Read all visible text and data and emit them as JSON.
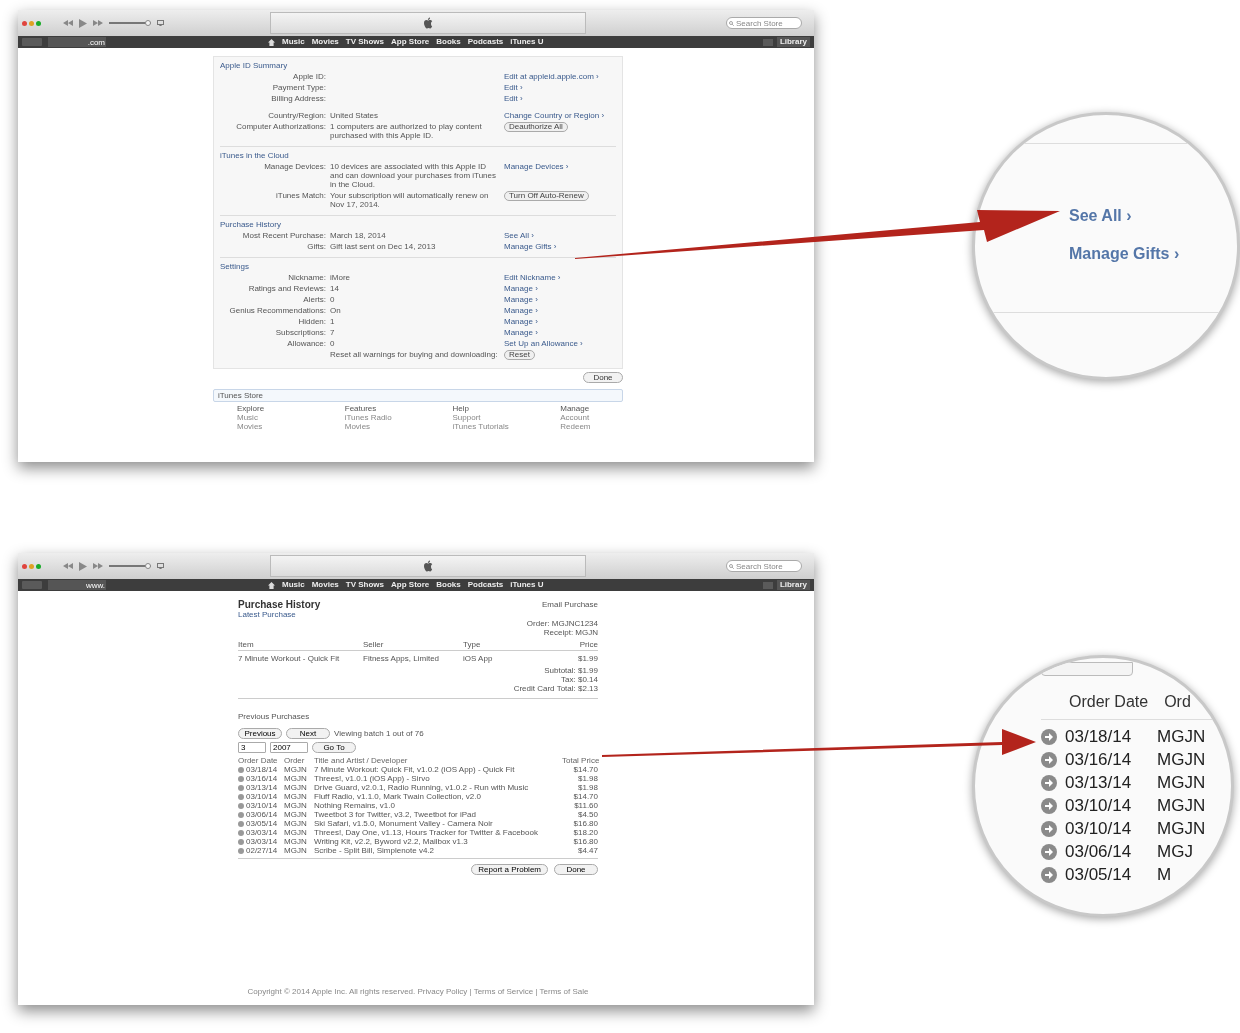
{
  "top_window": {
    "volume": {
      "level": 0.95
    },
    "search": {
      "placeholder": "Search Store"
    },
    "address": ".com",
    "nav": [
      "Music",
      "Movies",
      "TV Shows",
      "App Store",
      "Books",
      "Podcasts",
      "iTunes U"
    ],
    "library": "Library",
    "sections": [
      {
        "title": "Apple ID Summary",
        "rows": [
          {
            "label": "Apple ID:",
            "value": "",
            "action": "Edit at appleid.apple.com ›",
            "kind": "link"
          },
          {
            "label": "Payment Type:",
            "value": "",
            "action": "Edit ›",
            "kind": "link"
          },
          {
            "label": "Billing Address:",
            "value": "",
            "action": "Edit ›",
            "kind": "link"
          },
          {
            "label": "Country/Region:",
            "value": "United States",
            "action": "Change Country or Region ›",
            "kind": "link"
          },
          {
            "label": "Computer Authorizations:",
            "value": "1 computers are authorized to play content purchased with this Apple ID.",
            "action": "Deauthorize All",
            "kind": "button"
          }
        ]
      },
      {
        "title": "iTunes in the Cloud",
        "rows": [
          {
            "label": "Manage Devices:",
            "value": "10 devices are associated with this Apple ID and can download your purchases from iTunes in the Cloud.",
            "action": "Manage Devices ›",
            "kind": "link"
          },
          {
            "label": "iTunes Match:",
            "value": "Your subscription will automatically renew on Nov 17, 2014.",
            "action": "Turn Off Auto-Renew",
            "kind": "button"
          }
        ]
      },
      {
        "title": "Purchase History",
        "rows": [
          {
            "label": "Most Recent Purchase:",
            "value": "March 18, 2014",
            "action": "See All ›",
            "kind": "link"
          },
          {
            "label": "Gifts:",
            "value": "Gift last sent on Dec 14, 2013",
            "action": "Manage Gifts ›",
            "kind": "link"
          }
        ]
      },
      {
        "title": "Settings",
        "rows": [
          {
            "label": "Nickname:",
            "value": "iMore",
            "action": "Edit Nickname ›",
            "kind": "link"
          },
          {
            "label": "Ratings and Reviews:",
            "value": "14",
            "action": "Manage ›",
            "kind": "link"
          },
          {
            "label": "Alerts:",
            "value": "0",
            "action": "Manage ›",
            "kind": "link"
          },
          {
            "label": "Genius Recommendations:",
            "value": "On",
            "action": "Manage ›",
            "kind": "link"
          },
          {
            "label": "Hidden:",
            "value": "1",
            "action": "Manage ›",
            "kind": "link"
          },
          {
            "label": "Subscriptions:",
            "value": "7",
            "action": "Manage ›",
            "kind": "link"
          },
          {
            "label": "Allowance:",
            "value": "0",
            "action": "Set Up an Allowance ›",
            "kind": "link"
          },
          {
            "label": "",
            "value": "Reset all warnings for buying and downloading:",
            "action": "Reset",
            "kind": "button"
          }
        ]
      }
    ],
    "done": "Done",
    "store_bar": "iTunes Store",
    "footer_columns": [
      {
        "heading": "Explore",
        "items": [
          "Music",
          "Movies"
        ]
      },
      {
        "heading": "Features",
        "items": [
          "iTunes Radio",
          "Movies"
        ]
      },
      {
        "heading": "Help",
        "items": [
          "Support",
          "iTunes Tutorials"
        ]
      },
      {
        "heading": "Manage",
        "items": [
          "Account",
          "Redeem"
        ]
      }
    ]
  },
  "bottom_window": {
    "volume": {
      "level": 0.95
    },
    "search": {
      "placeholder": "Search Store"
    },
    "address": "www.",
    "nav": [
      "Music",
      "Movies",
      "TV Shows",
      "App Store",
      "Books",
      "Podcasts",
      "iTunes U"
    ],
    "library": "Library",
    "title": "Purchase History",
    "email_link": "Email Purchase",
    "subtitle": "Latest Purchase",
    "order_info": [
      "Order: MGJNC1234",
      "Receipt: MGJN"
    ],
    "latest_columns": [
      "Item",
      "Seller",
      "Type",
      "Price"
    ],
    "latest_row": [
      "7 Minute Workout - Quick Fit",
      "Fitness Apps, Limited",
      "iOS App",
      "$1.99"
    ],
    "totals": [
      "Subtotal: $1.99",
      "Tax: $0.14",
      "Credit Card Total: $2.13"
    ],
    "previous_title": "Previous Purchases",
    "previous": "Previous",
    "next": "Next",
    "batch": "Viewing batch 1 out of 76",
    "month": "3",
    "year": "2007",
    "go": "Go To",
    "table_columns": [
      "Order Date",
      "Order",
      "Title and Artist / Developer",
      "Total Price"
    ],
    "rows": [
      [
        "03/18/14",
        "MGJN",
        "7 Minute Workout: Quick Fit, v1.0.2 (iOS App) - Quick Fit",
        "$14.70"
      ],
      [
        "03/16/14",
        "MGJN",
        "Threes!, v1.0.1 (iOS App) - Sirvo",
        "$1.98"
      ],
      [
        "03/13/14",
        "MGJN",
        "Drive Guard, v2.0.1, Radio Running, v1.0.2 - Run with Music",
        "$1.98"
      ],
      [
        "03/10/14",
        "MGJN",
        "Fluff Radio, v1.1.0, Mark Twain Collection, v2.0",
        "$14.70"
      ],
      [
        "03/10/14",
        "MGJN",
        "Nothing Remains, v1.0",
        "$11.60"
      ],
      [
        "03/06/14",
        "MGJN",
        "Tweetbot 3 for Twitter, v3.2, Tweetbot for iPad",
        "$4.50"
      ],
      [
        "03/05/14",
        "MGJN",
        "Ski Safari, v1.5.0, Monument Valley - Camera Noir",
        "$16.80"
      ],
      [
        "03/03/14",
        "MGJN",
        "Threes!, Day One, v1.13, Hours Tracker for Twitter & Facebook",
        "$18.20"
      ],
      [
        "03/03/14",
        "MGJN",
        "Writing Kit, v2.2, Byword v2.2, Mailbox v1.3",
        "$16.80"
      ],
      [
        "02/27/14",
        "MGJN",
        "Scribe - Split Bill, Simplenote v4.2",
        "$4.47"
      ]
    ],
    "report": "Report a Problem",
    "done": "Done",
    "copyright": "Copyright © 2014 Apple Inc. All rights reserved. Privacy Policy | Terms of Service | Terms of Sale"
  },
  "zoom_gifts": {
    "links": [
      "See All ›",
      "Manage Gifts ›"
    ]
  },
  "zoom_orders": {
    "columns": [
      "Order Date",
      "Ord"
    ],
    "rows": [
      [
        "03/18/14",
        "MGJN"
      ],
      [
        "03/16/14",
        "MGJN"
      ],
      [
        "03/13/14",
        "MGJN"
      ],
      [
        "03/10/14",
        "MGJN"
      ],
      [
        "03/10/14",
        "MGJN"
      ],
      [
        "03/06/14",
        "MGJ"
      ],
      [
        "03/05/14",
        "M"
      ]
    ]
  }
}
